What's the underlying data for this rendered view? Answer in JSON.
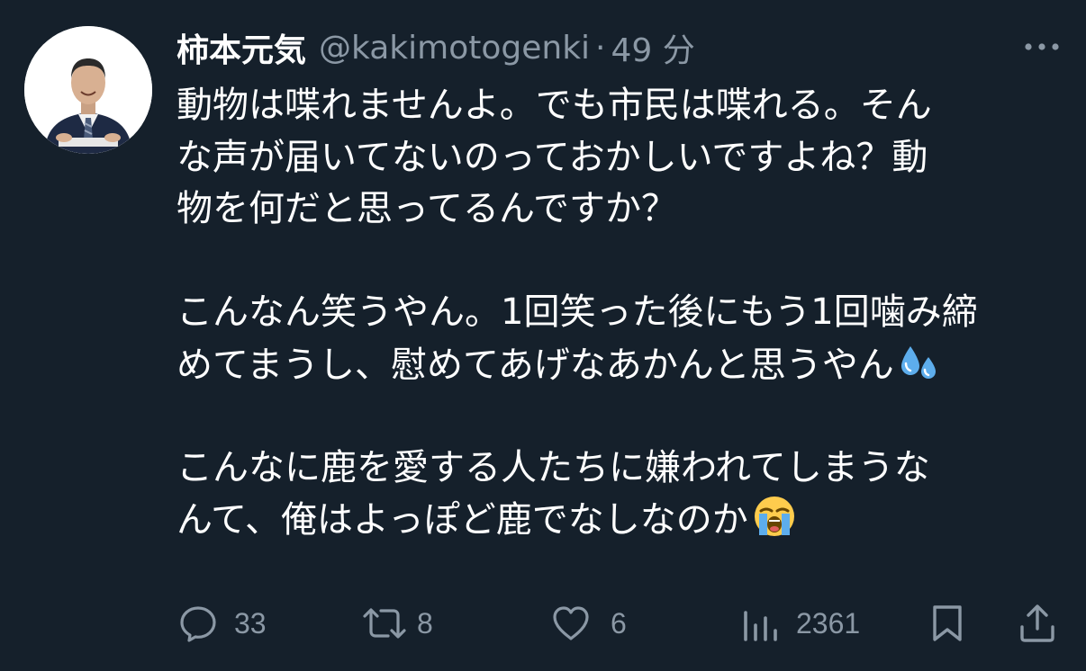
{
  "tweet": {
    "display_name": "柿本元気",
    "handle": "@kakimotogenki",
    "separator": "·",
    "time": "49 分",
    "text_lines": [
      "動物は喋れませんよ。でも市民は喋れる。そん",
      "な声が届いてないのっておかしいですよね？動",
      "物を何だと思ってるんですか？",
      "",
      "こんなん笑うやん。1回笑った後にもう1回噛み締",
      "めてまうし、慰めてあげなあかんと思うやん",
      "",
      "こんなに鹿を愛する人たちに嫌われてしまうな",
      "んて、俺はよっぽど鹿でなしなのか"
    ],
    "emojis": [
      "sweat-droplets-emoji",
      "loudly-crying-face-emoji"
    ]
  },
  "actions": {
    "replies": "33",
    "retweets": "8",
    "likes": "6",
    "views": "2361"
  },
  "colors": {
    "background": "#15202b",
    "text": "#ffffff",
    "muted": "#8b98a5"
  },
  "icons": [
    "more-icon",
    "reply-icon",
    "retweet-icon",
    "like-icon",
    "views-icon",
    "bookmark-icon",
    "share-icon"
  ]
}
